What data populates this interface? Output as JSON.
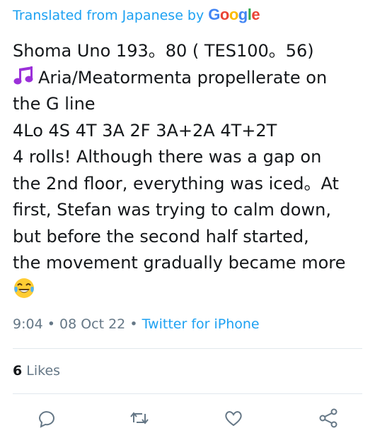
{
  "translation": {
    "label": "Translated from Japanese by",
    "provider": "Google",
    "provider_letters": [
      {
        "ch": "G",
        "color": "#4285F4"
      },
      {
        "ch": "o",
        "color": "#EA4335"
      },
      {
        "ch": "o",
        "color": "#FBBC05"
      },
      {
        "ch": "g",
        "color": "#4285F4"
      },
      {
        "ch": "l",
        "color": "#34A853"
      },
      {
        "ch": "e",
        "color": "#EA4335"
      }
    ]
  },
  "tweet": {
    "lines": [
      "Shoma Uno 193。80 ( TES100。56)",
      "Aria/Meatormenta propellerate on",
      "the G line",
      "4Lo 4S 4T 3A 2F 3A+2A 4T+2T",
      "4 rolls! Although there was a gap on",
      "the 2nd floor, everything was iced。At",
      "first, Stefan was trying to calm down,",
      "but before the second half started,",
      "the movement gradually became more"
    ],
    "music_icon": "music-note-icon",
    "emoji_icon": "laughing-tears-emoji-icon"
  },
  "meta": {
    "time": "9:04",
    "separator": "•",
    "date": "08 Oct 22",
    "source": "Twitter for iPhone"
  },
  "stats": {
    "likes_count": "6",
    "likes_label": "Likes"
  },
  "actions": [
    "reply-icon",
    "retweet-icon",
    "like-icon",
    "share-icon"
  ],
  "colors": {
    "link": "#1da1f2",
    "muted": "#657786",
    "text": "#14171a",
    "music_note": "#9b30d9"
  }
}
